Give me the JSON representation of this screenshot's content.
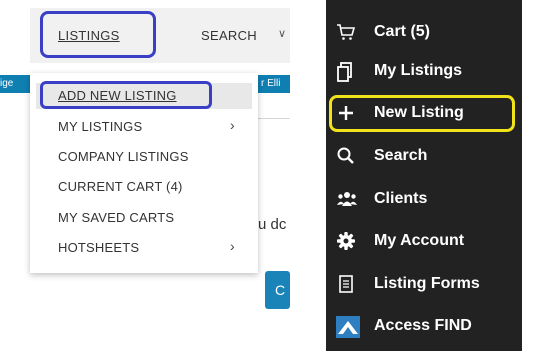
{
  "topnav": {
    "listings_label": "LISTINGS",
    "search_label": "SEARCH"
  },
  "background": {
    "left_strip_text": "ige",
    "right_strip_text": "r Elli",
    "partial_text": "u dc",
    "partial_button": "C"
  },
  "dropdown": {
    "items": [
      {
        "label": "ADD NEW LISTING",
        "submenu": false
      },
      {
        "label": "MY LISTINGS",
        "submenu": true
      },
      {
        "label": "COMPANY LISTINGS",
        "submenu": false
      },
      {
        "label": "CURRENT CART (4)",
        "submenu": false
      },
      {
        "label": "MY SAVED CARTS",
        "submenu": false
      },
      {
        "label": "HOTSHEETS",
        "submenu": true
      }
    ]
  },
  "mobile_menu": {
    "items": [
      {
        "label": "Cart (5)",
        "icon": "cart-icon"
      },
      {
        "label": "My Listings",
        "icon": "copy-icon"
      },
      {
        "label": "New Listing",
        "icon": "plus-icon"
      },
      {
        "label": "Search",
        "icon": "search-icon"
      },
      {
        "label": "Clients",
        "icon": "users-icon"
      },
      {
        "label": "My Account",
        "icon": "gear-icon"
      },
      {
        "label": "Listing Forms",
        "icon": "document-icon"
      },
      {
        "label": "Access FIND",
        "icon": "find-logo-icon"
      }
    ]
  },
  "colors": {
    "highlight_blue": "#3b3fc6",
    "highlight_yellow": "#f2e21a",
    "menu_bg": "#222222",
    "strip_blue": "#0f7fb2"
  }
}
